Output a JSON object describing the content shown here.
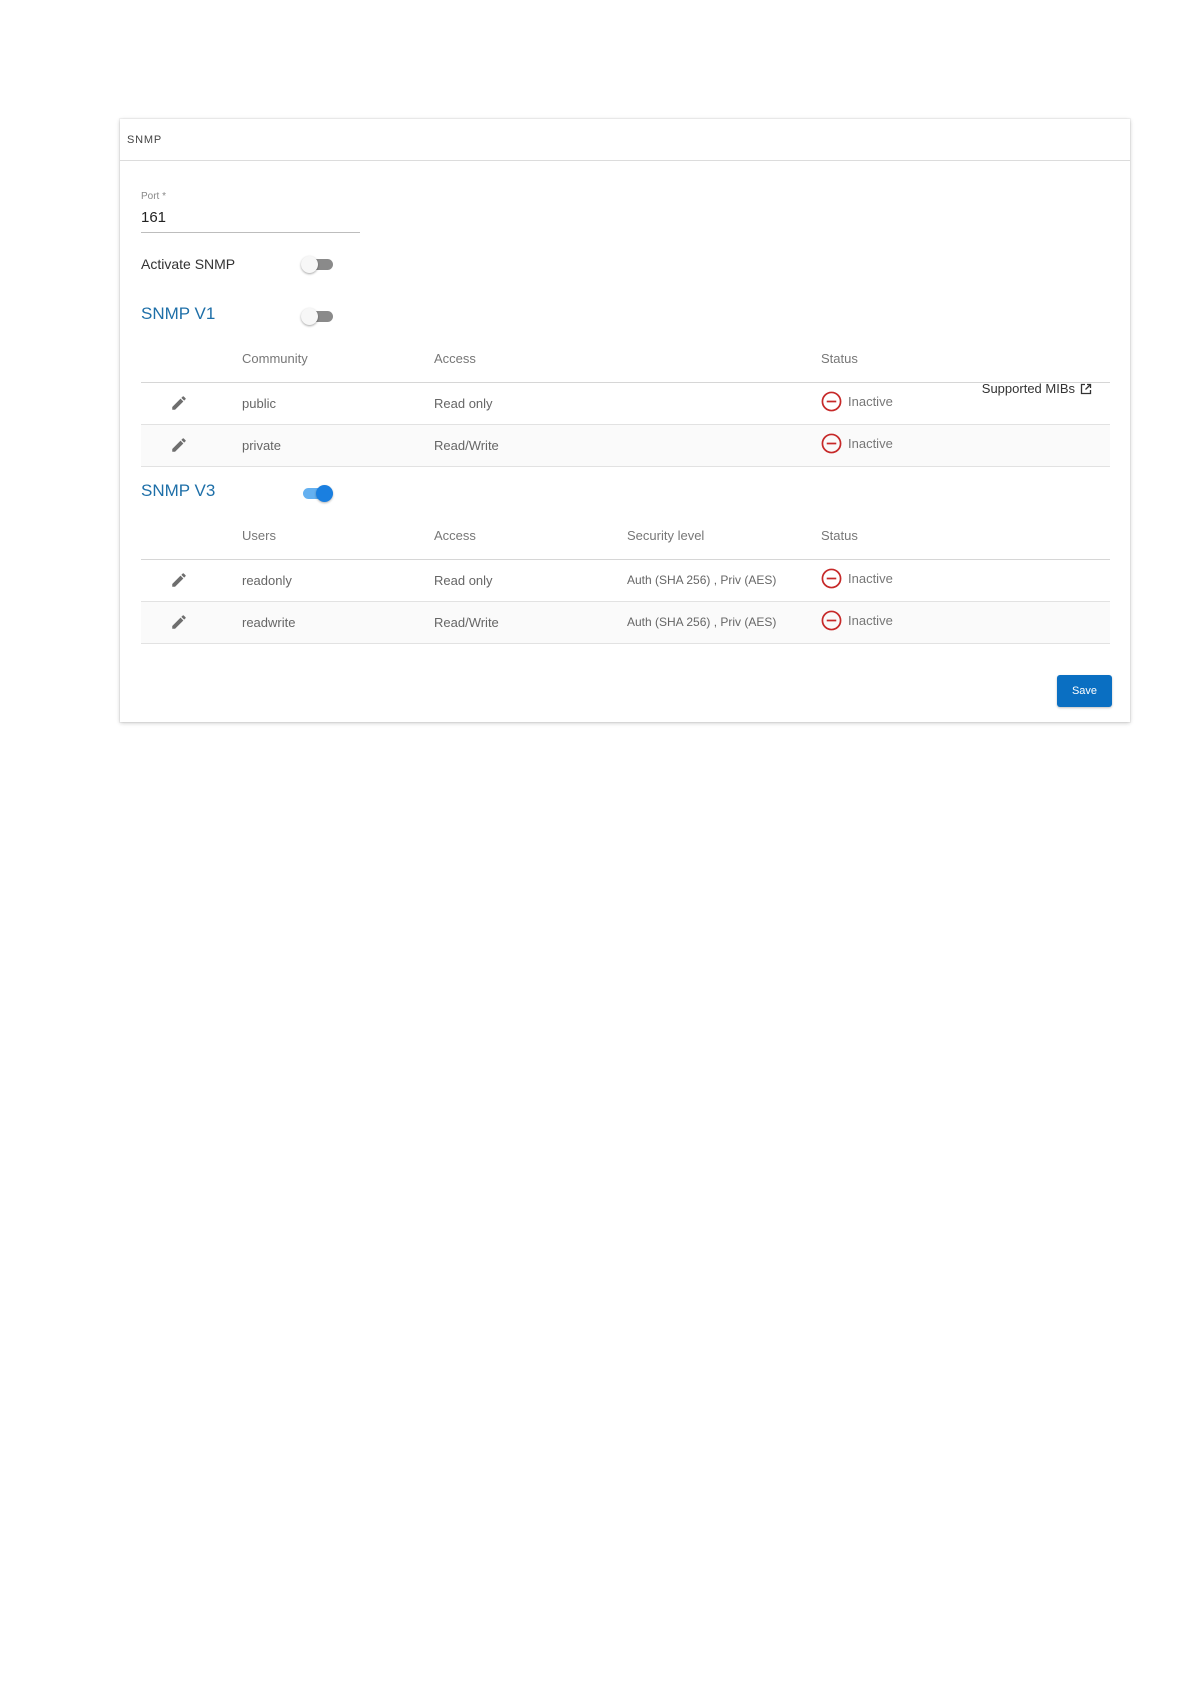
{
  "card": {
    "title": "SNMP"
  },
  "port": {
    "label": "Port *",
    "value": "161"
  },
  "activate": {
    "label": "Activate SNMP",
    "enabled": false
  },
  "mibs": {
    "label": "Supported MIBs",
    "icon": "external-link-icon"
  },
  "v1": {
    "title": "SNMP V1",
    "enabled": false,
    "headers": {
      "name": "Community",
      "access": "Access",
      "status": "Status"
    },
    "rows": [
      {
        "name": "public",
        "access": "Read only",
        "status": "Inactive"
      },
      {
        "name": "private",
        "access": "Read/Write",
        "status": "Inactive"
      }
    ]
  },
  "v3": {
    "title": "SNMP V3",
    "enabled": true,
    "headers": {
      "name": "Users",
      "access": "Access",
      "security": "Security level",
      "status": "Status"
    },
    "rows": [
      {
        "name": "readonly",
        "access": "Read only",
        "security": "Auth (SHA 256) , Priv (AES)",
        "status": "Inactive"
      },
      {
        "name": "readwrite",
        "access": "Read/Write",
        "security": "Auth (SHA 256) , Priv (AES)",
        "status": "Inactive"
      }
    ]
  },
  "actions": {
    "save": "Save"
  },
  "colors": {
    "accent": "#1e6fa8",
    "primary_button": "#0a6fc2",
    "inactive": "#c62828",
    "toggle_on": "#1a7fe0"
  }
}
